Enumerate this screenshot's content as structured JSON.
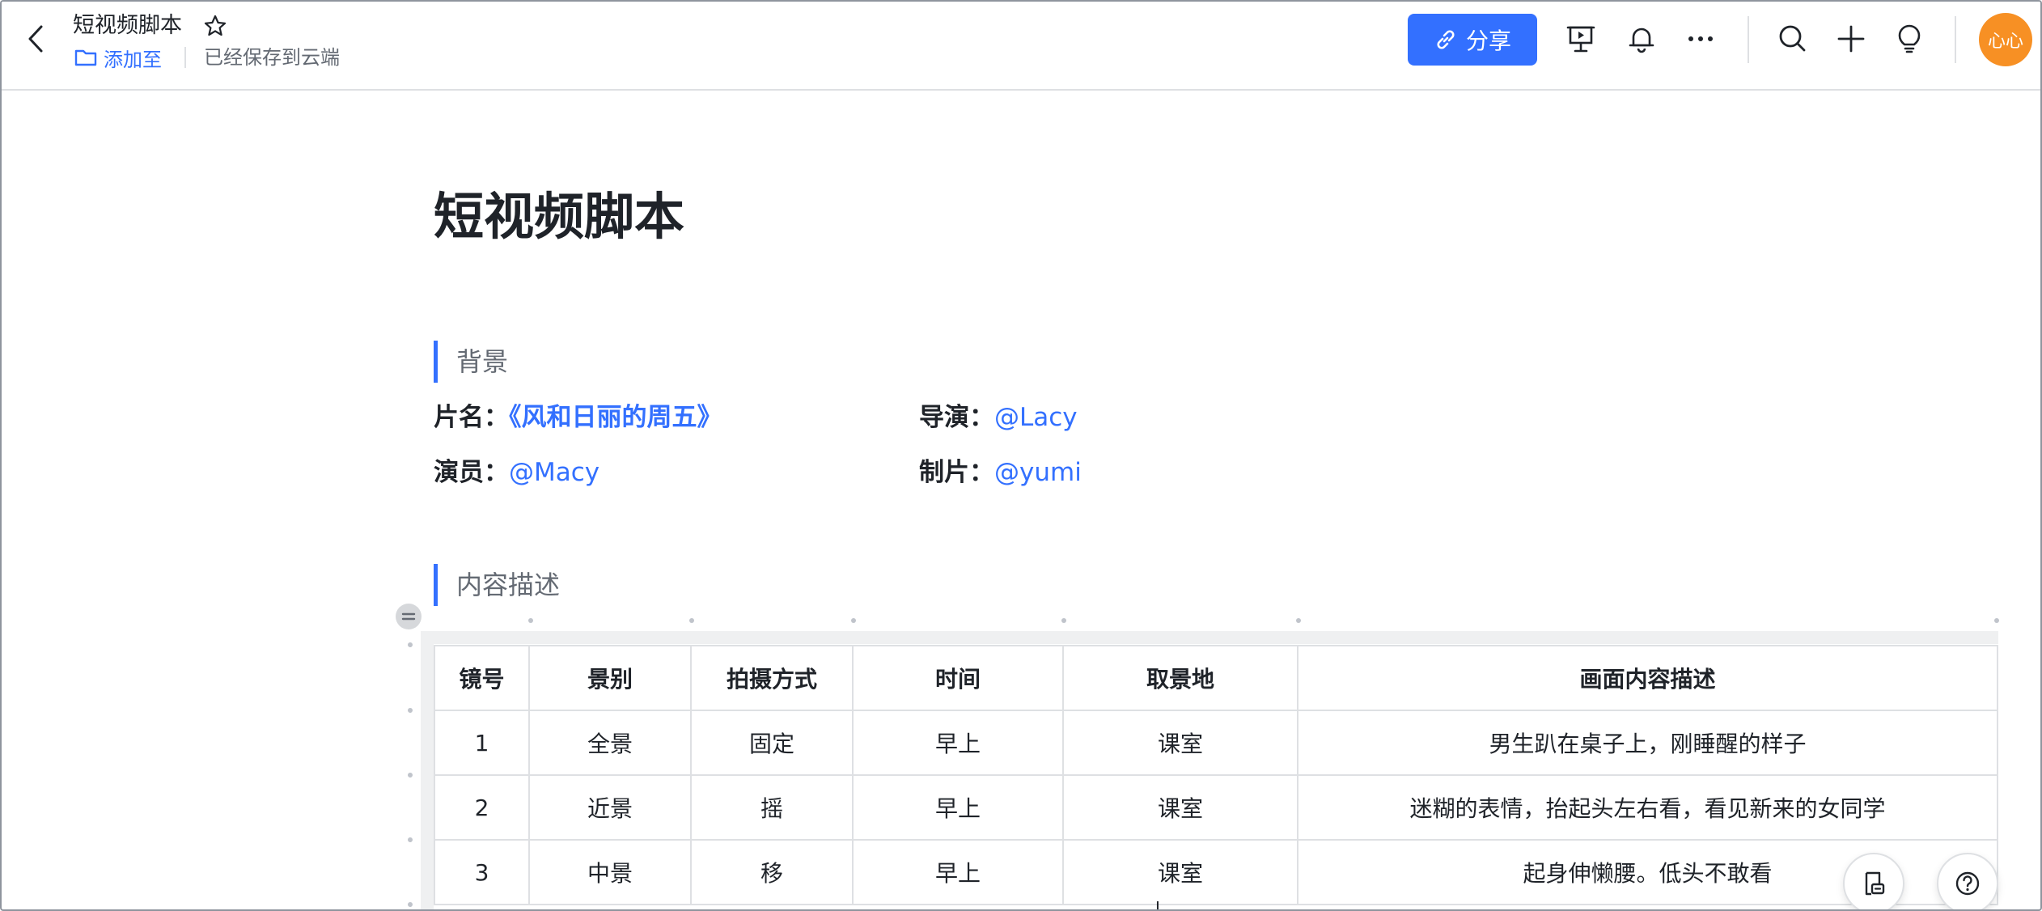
{
  "header": {
    "doc_title": "短视频脚本",
    "add_to_label": "添加至",
    "save_status": "已经保存到云端",
    "share_label": "分享",
    "avatar_text": "心心",
    "avatar_color": "#f79024",
    "accent_color": "#3370ff",
    "icons": [
      "back-icon",
      "star-icon",
      "folder-icon",
      "link-icon",
      "present-icon",
      "bell-icon",
      "more-icon",
      "search-icon",
      "plus-icon",
      "bulb-icon"
    ]
  },
  "document": {
    "title": "短视频脚本",
    "background_heading": "背景",
    "fields": {
      "film_name_label": "片名：",
      "film_name_value": "《风和日丽的周五》",
      "director_label": "导演：",
      "director_value": "@Lacy",
      "actor_label": "演员：",
      "actor_value": "@Macy",
      "producer_label": "制片：",
      "producer_value": "@yumi"
    },
    "content_heading": "内容描述"
  },
  "table": {
    "headers": [
      "镜号",
      "景别",
      "拍摄方式",
      "时间",
      "取景地",
      "画面内容描述"
    ],
    "rows": [
      [
        "1",
        "全景",
        "固定",
        "早上",
        "课室",
        "男生趴在桌子上，刚睡醒的样子"
      ],
      [
        "2",
        "近景",
        "摇",
        "早上",
        "课室",
        "迷糊的表情，抬起头左右看，看见新来的女同学"
      ],
      [
        "3",
        "中景",
        "移",
        "早上",
        "课室",
        "起身伸懒腰。低头不敢看"
      ]
    ]
  },
  "floating": {
    "icons": [
      "doc-review-icon",
      "help-icon"
    ]
  }
}
